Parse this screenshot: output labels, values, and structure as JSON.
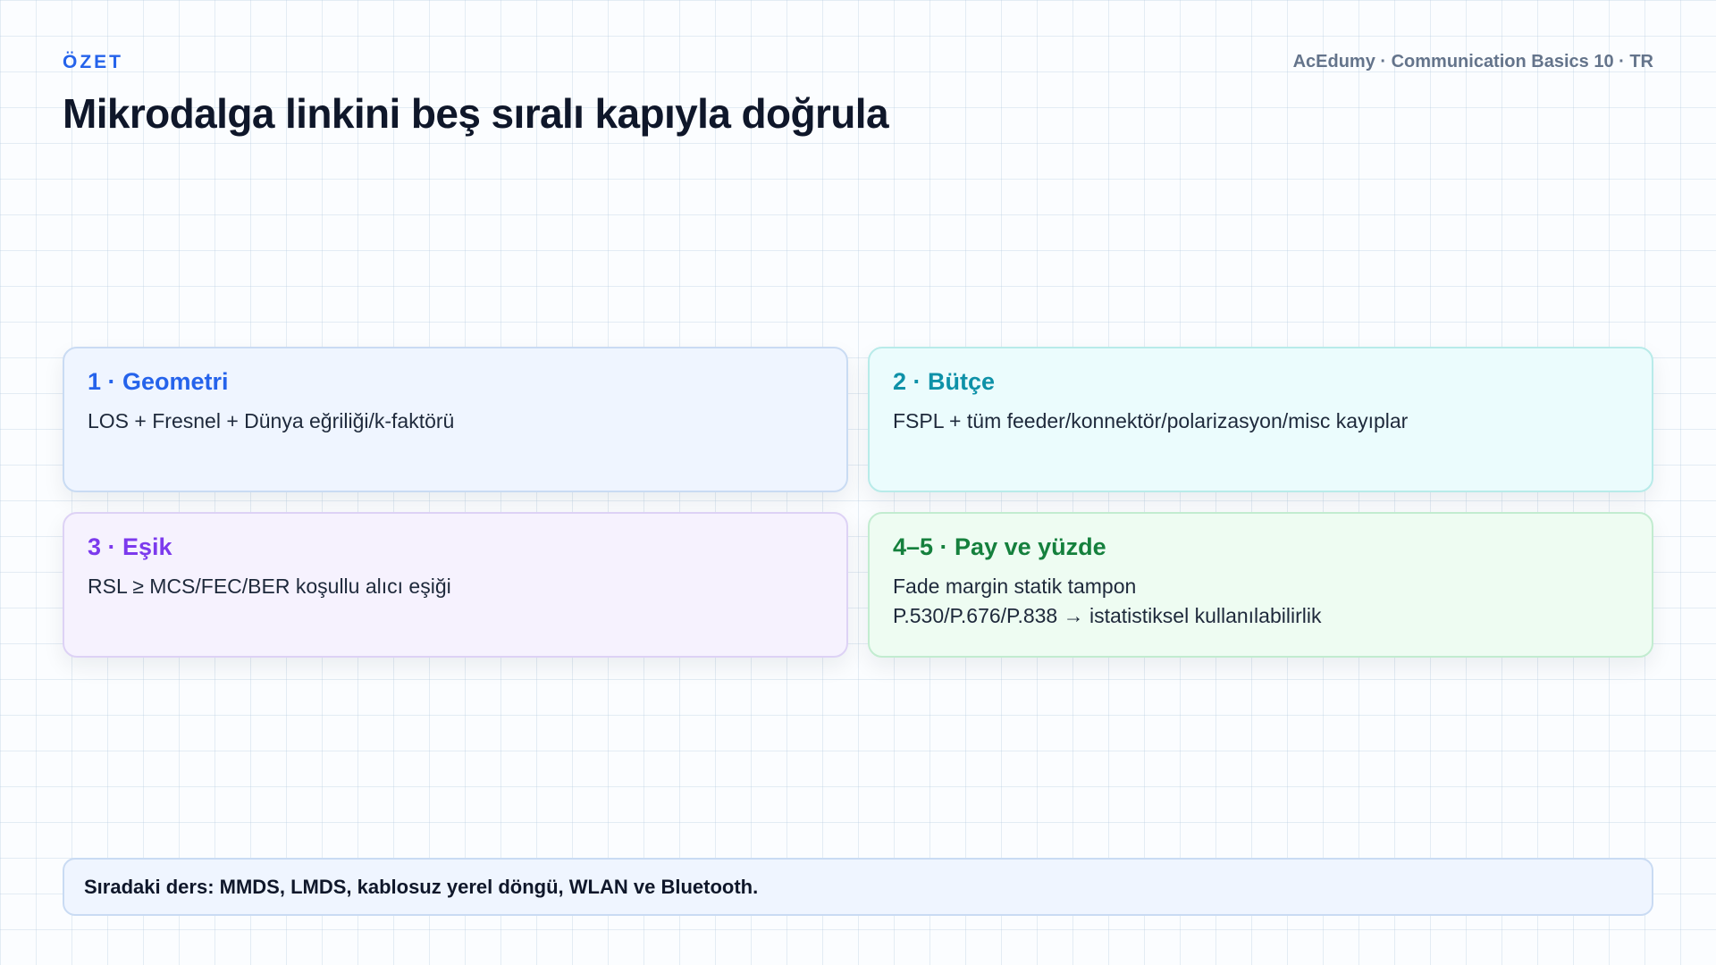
{
  "header": {
    "eyebrow": "ÖZET",
    "course": "AcEdumy · Communication Basics 10 · TR",
    "title": "Mikrodalga linkini beş sıralı kapıyla doğrula"
  },
  "cards": [
    {
      "heading": "1 · Geometri",
      "lines": [
        "LOS + Fresnel + Dünya eğriliği/k-faktörü"
      ]
    },
    {
      "heading": "2 · Bütçe",
      "lines": [
        "FSPL + tüm feeder/konnektör/polarizasyon/misc kayıplar"
      ]
    },
    {
      "heading": "3 · Eşik",
      "lines": [
        "RSL ≥ MCS/FEC/BER koşullu alıcı eşiği"
      ]
    },
    {
      "heading": "4–5 · Pay ve yüzde",
      "lines": [
        "Fade margin statik tampon",
        "P.530/P.676/P.838 → istatistiksel kullanılabilirlik"
      ]
    }
  ],
  "footer": {
    "text": "Sıradaki ders: MMDS, LMDS, kablosuz yerel döngü, WLAN ve Bluetooth."
  },
  "colors": {
    "accent_blue": "#2563eb",
    "accent_teal": "#0e91a8",
    "accent_violet": "#7c3aed",
    "accent_green": "#15803d",
    "title": "#0f172a",
    "muted": "#64748b"
  }
}
